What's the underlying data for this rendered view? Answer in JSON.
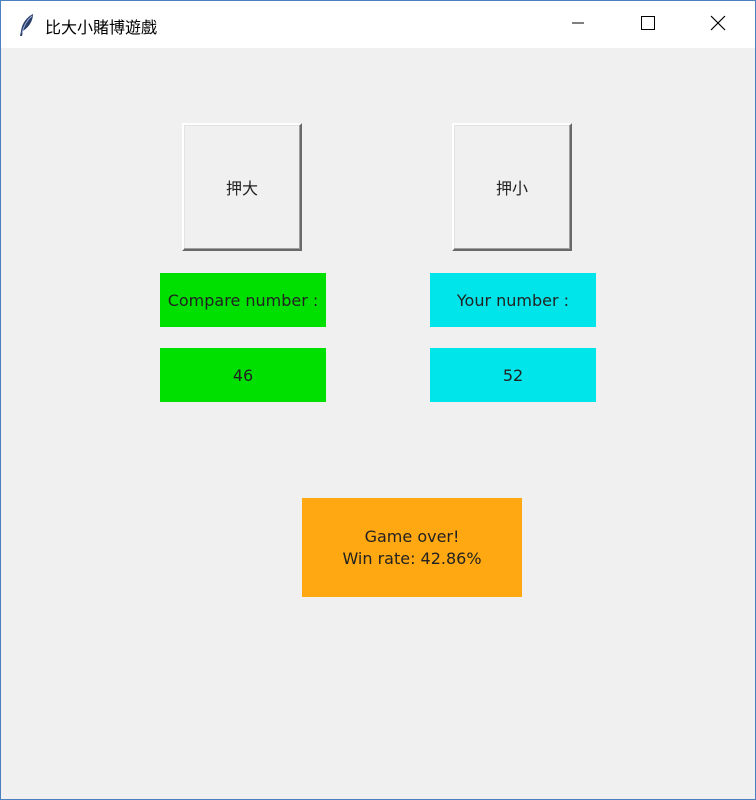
{
  "window": {
    "title": "比大小賭博遊戲",
    "app_icon": "feather-icon"
  },
  "buttons": {
    "bet_high_label": "押大",
    "bet_low_label": "押小"
  },
  "labels": {
    "compare_label": "Compare number :",
    "your_label": "Your number :",
    "compare_value": "46",
    "your_value": "52"
  },
  "result": {
    "line1": "Game over!",
    "line2": "Win rate: 42.86%"
  },
  "colors": {
    "compare_bg": "#00e000",
    "your_bg": "#00e5ea",
    "result_bg": "#ffa812"
  }
}
